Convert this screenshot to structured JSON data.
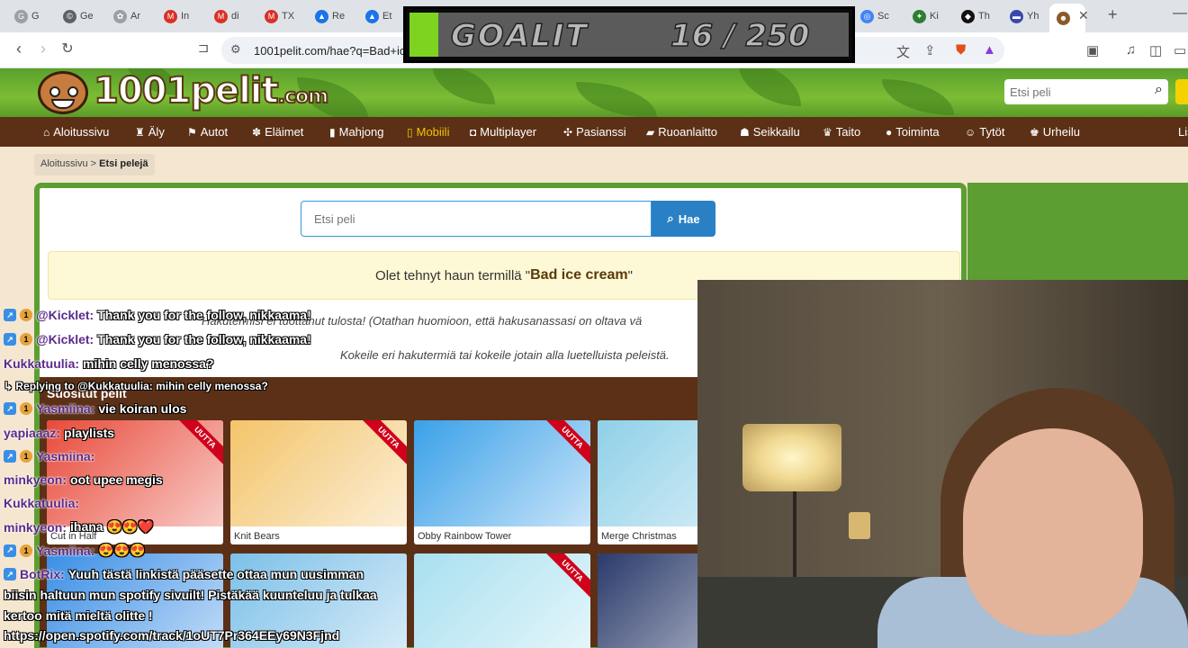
{
  "browser": {
    "tabs": [
      {
        "title": "G",
        "color": "#9aa0a6",
        "glyph": "G"
      },
      {
        "title": "Ge",
        "color": "#5f6368",
        "glyph": "©"
      },
      {
        "title": "Ar",
        "color": "#9aa0a6",
        "glyph": "✿"
      },
      {
        "title": "In",
        "color": "#d93025",
        "glyph": "M"
      },
      {
        "title": "di",
        "color": "#d93025",
        "glyph": "M"
      },
      {
        "title": "TX",
        "color": "#d93025",
        "glyph": "M"
      },
      {
        "title": "Re",
        "color": "#1a73e8",
        "glyph": "▲"
      },
      {
        "title": "Et",
        "color": "#1a73e8",
        "glyph": "▲"
      },
      {
        "title": "Sc",
        "color": "#4285f4",
        "glyph": "◎"
      },
      {
        "title": "Ki",
        "color": "#2e7d32",
        "glyph": "✦"
      },
      {
        "title": "Th",
        "color": "#111111",
        "glyph": "◆"
      },
      {
        "title": "Yh",
        "color": "#3949ab",
        "glyph": "▬"
      }
    ],
    "active_tab_icon": "monkey-favicon",
    "url": "1001pelit.com/hae?q=Bad+ic"
  },
  "goal": {
    "label": "GOALIT",
    "count": "16 / 250",
    "fraction": 0.064,
    "fill_color": "#7ed321"
  },
  "site": {
    "logo_main": "1001pelit",
    "logo_suffix": ".com",
    "search_placeholder": "Etsi peli",
    "categories": [
      {
        "label": "Aloitussivu",
        "icon": "home-icon",
        "glyph": "⌂",
        "active": false
      },
      {
        "label": "Äly",
        "icon": "chess-icon",
        "glyph": "♜",
        "active": false
      },
      {
        "label": "Autot",
        "icon": "flag-icon",
        "glyph": "⚑",
        "active": false
      },
      {
        "label": "Eläimet",
        "icon": "paw-icon",
        "glyph": "✽",
        "active": false
      },
      {
        "label": "Mahjong",
        "icon": "tile-icon",
        "glyph": "▮",
        "active": false
      },
      {
        "label": "Mobiili",
        "icon": "mobile-icon",
        "glyph": "▯",
        "active": true
      },
      {
        "label": "Multiplayer",
        "icon": "gamepad-icon",
        "glyph": "◘",
        "active": false
      },
      {
        "label": "Pasianssi",
        "icon": "cards-icon",
        "glyph": "✣",
        "active": false
      },
      {
        "label": "Ruoanlaitto",
        "icon": "pot-icon",
        "glyph": "▰",
        "active": false
      },
      {
        "label": "Seikkailu",
        "icon": "treasure-icon",
        "glyph": "☗",
        "active": false
      },
      {
        "label": "Taito",
        "icon": "trophy-icon",
        "glyph": "♛",
        "active": false
      },
      {
        "label": "Toiminta",
        "icon": "bomb-icon",
        "glyph": "●",
        "active": false
      },
      {
        "label": "Tytöt",
        "icon": "girl-icon",
        "glyph": "☺",
        "active": false
      },
      {
        "label": "Urheilu",
        "icon": "trophy-icon",
        "glyph": "♚",
        "active": false
      },
      {
        "label": "Lis",
        "icon": "",
        "glyph": "",
        "active": false
      }
    ],
    "breadcrumb": {
      "home": "Aloitussivu",
      "sep": ">",
      "current": "Etsi pelejä"
    },
    "search_input_placeholder": "Etsi peli",
    "search_button": "Hae",
    "notice_prefix": "Olet tehnyt haun termillä \"",
    "notice_term": "Bad ice cream",
    "notice_suffix": "\"",
    "info_line1": "Hakutermisi ei tuottanut tulosta! (Otathan huomioon, että hakusanassasi on oltava vä",
    "info_line2": "Kokeile eri hakutermiä tai kokeile jotain alla luetelluista peleistä.",
    "popular_title": "Suositut pelit",
    "new_badge": "UUTTA",
    "games": [
      {
        "title": "Cut in Half",
        "bg": "#e84a3a",
        "new": true
      },
      {
        "title": "Knit Bears",
        "bg": "#f3c46a",
        "new": true
      },
      {
        "title": "Obby Rainbow Tower",
        "bg": "#3aa0e8",
        "new": true
      },
      {
        "title": "Merge Christmas",
        "bg": "#8fd0e8",
        "new": false
      },
      {
        "title": "",
        "bg": "#3a8ee6",
        "new": false
      },
      {
        "title": "",
        "bg": "#7cc0e8",
        "new": false
      },
      {
        "title": "",
        "bg": "#a8e0f0",
        "new": true
      },
      {
        "title": "",
        "bg": "#2a3a6a",
        "new": false
      }
    ]
  },
  "chat": [
    {
      "user": "@Kicklet:",
      "text": "Thank you for the follow, nikkaama!",
      "badges": 2
    },
    {
      "user": "@Kicklet:",
      "text": "Thank you for the follow, nikkaama!",
      "badges": 2
    },
    {
      "user": "Kukkatuulia:",
      "text": "mihin celly menossa?",
      "badges": 0
    },
    {
      "user": "",
      "text": "↳ Replying to @Kukkatuulia: mihin celly menossa?",
      "badges": 0
    },
    {
      "user": "Yasmiina:",
      "text": "vie koiran ulos",
      "badges": 2
    },
    {
      "user": "yapiaaaz:",
      "text": "playlists",
      "badges": 0
    },
    {
      "user": "Yasmiina:",
      "text": "",
      "badges": 2
    },
    {
      "user": "minkyeon:",
      "text": "oot upee megis",
      "badges": 0
    },
    {
      "user": "Kukkatuulia:",
      "text": "",
      "badges": 0
    },
    {
      "user": "minkyeon:",
      "text": "ihana 😍😍❤️",
      "badges": 0
    },
    {
      "user": "Yasmiina:",
      "text": "😍😍😍",
      "badges": 2
    },
    {
      "user": "BotRix:",
      "text": "Yuuh tästä linkistä pääsette ottaa mun uusimman",
      "badges": 1
    },
    {
      "user": "",
      "text": "biisin haltuun mun spotify sivuilt! Pistäkää kuunteluu ja tulkaa",
      "badges": 0
    },
    {
      "user": "",
      "text": "kertoo mitä mieltä olitte !",
      "badges": 0
    },
    {
      "user": "",
      "text": "https://open.spotify.com/track/1oUT7Pr364EEy69N3Fjnd",
      "badges": 0
    }
  ]
}
